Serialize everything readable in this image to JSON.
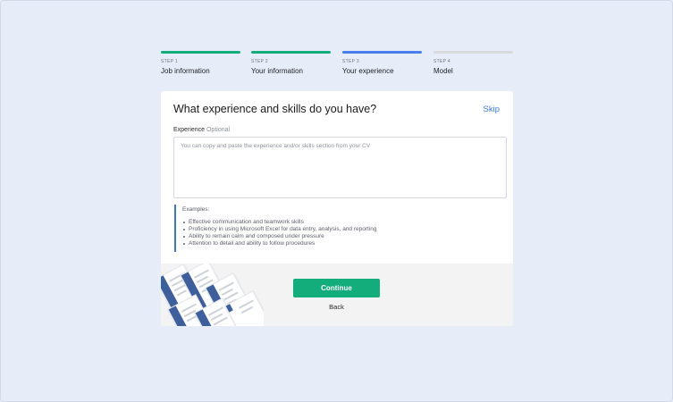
{
  "colors": {
    "background": "#e7edf8",
    "step_complete": "#12ad7b",
    "step_current": "#4a7ded",
    "step_pending": "#d8dade",
    "accent_link": "#3a78e0",
    "primary_button": "#12ad7b",
    "examples_border": "#3e6fe3"
  },
  "stepper": {
    "steps": [
      {
        "label": "STEP 1",
        "name": "Job information",
        "status": "complete"
      },
      {
        "label": "STEP 2",
        "name": "Your information",
        "status": "complete"
      },
      {
        "label": "STEP 3",
        "name": "Your experience",
        "status": "current"
      },
      {
        "label": "STEP 4",
        "name": "Model",
        "status": "pending"
      }
    ]
  },
  "card": {
    "title": "What experience and skills do you have?",
    "skip_label": "Skip",
    "field": {
      "label": "Experience",
      "optional": "Optional",
      "value": "",
      "placeholder": "You can copy and paste the experience and/or skills section from your CV"
    },
    "examples": {
      "title": "Examples:",
      "items": [
        "Effective communication and teamwork skills",
        "Proficiency in using Microsoft Excel for data entry, analysis, and reporting",
        "Ability to remain calm and composed under pressure",
        "Attention to detail and ability to follow procedures"
      ]
    },
    "footer": {
      "continue_label": "Continue",
      "back_label": "Back"
    }
  }
}
